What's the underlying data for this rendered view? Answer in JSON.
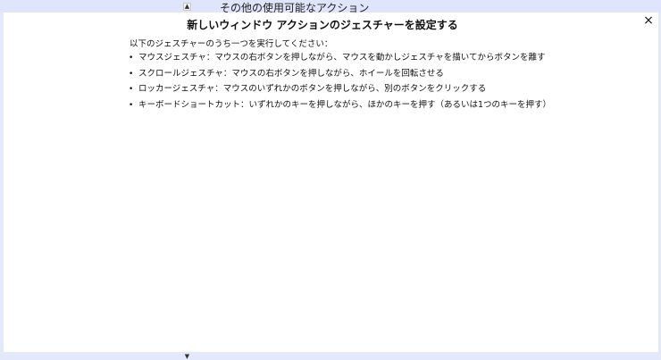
{
  "background": {
    "title": "その他の使用可能なアクション",
    "scroll_up_icon": "▲",
    "scroll_down_icon": "▼"
  },
  "dialog": {
    "title": "新しいウィンドウ アクションのジェスチャーを設定する",
    "close_label": "×",
    "intro": "以下のジェスチャーのうち一つを実行してください：",
    "gestures": [
      "マウスジェスチャ：マウスの右ボタンを押しながら、マウスを動かしジェスチャを描いてからボタンを離す",
      "スクロールジェスチャ：マウスの右ボタンを押しながら、ホイールを回転させる",
      "ロッカージェスチャ：マウスのいずれかのボタンを押しながら、別のボタンをクリックする",
      "キーボードショートカット：いずれかのキーを押しながら、ほかのキーを押す（あるいは1つのキーを押す）"
    ]
  },
  "colors": {
    "backdrop": "#e3e8fb",
    "dialog_bg": "#ffffff"
  }
}
